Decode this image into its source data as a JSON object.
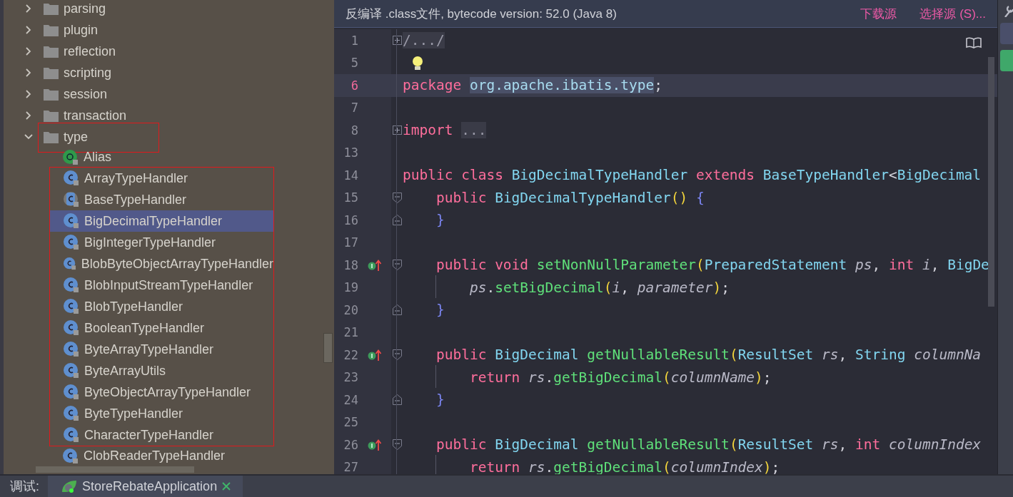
{
  "project_tree": {
    "items": [
      {
        "label": "parsing",
        "kind": "folder",
        "expanded": false,
        "selected": false,
        "outlined": false
      },
      {
        "label": "plugin",
        "kind": "folder",
        "expanded": false,
        "selected": false,
        "outlined": false
      },
      {
        "label": "reflection",
        "kind": "folder",
        "expanded": false,
        "selected": false,
        "outlined": false
      },
      {
        "label": "scripting",
        "kind": "folder",
        "expanded": false,
        "selected": false,
        "outlined": false
      },
      {
        "label": "session",
        "kind": "folder",
        "expanded": false,
        "selected": false,
        "outlined": false
      },
      {
        "label": "transaction",
        "kind": "folder",
        "expanded": false,
        "selected": false,
        "outlined": false
      },
      {
        "label": "type",
        "kind": "folder",
        "expanded": true,
        "selected": false,
        "outlined": true,
        "children": [
          {
            "label": "Alias",
            "kind": "annotation",
            "selected": false,
            "boxed": false
          },
          {
            "label": "ArrayTypeHandler",
            "kind": "class",
            "selected": false,
            "boxed": true
          },
          {
            "label": "BaseTypeHandler",
            "kind": "abstract",
            "selected": false,
            "boxed": true
          },
          {
            "label": "BigDecimalTypeHandler",
            "kind": "class",
            "selected": true,
            "boxed": true
          },
          {
            "label": "BigIntegerTypeHandler",
            "kind": "class",
            "selected": false,
            "boxed": true
          },
          {
            "label": "BlobByteObjectArrayTypeHandler",
            "kind": "class",
            "selected": false,
            "boxed": true
          },
          {
            "label": "BlobInputStreamTypeHandler",
            "kind": "class",
            "selected": false,
            "boxed": true
          },
          {
            "label": "BlobTypeHandler",
            "kind": "class",
            "selected": false,
            "boxed": true
          },
          {
            "label": "BooleanTypeHandler",
            "kind": "class",
            "selected": false,
            "boxed": true
          },
          {
            "label": "ByteArrayTypeHandler",
            "kind": "class",
            "selected": false,
            "boxed": true
          },
          {
            "label": "ByteArrayUtils",
            "kind": "class",
            "selected": false,
            "boxed": true
          },
          {
            "label": "ByteObjectArrayTypeHandler",
            "kind": "class",
            "selected": false,
            "boxed": true
          },
          {
            "label": "ByteTypeHandler",
            "kind": "class",
            "selected": false,
            "boxed": true
          },
          {
            "label": "CharacterTypeHandler",
            "kind": "class",
            "selected": false,
            "boxed": true
          },
          {
            "label": "ClobReaderTypeHandler",
            "kind": "class",
            "selected": false,
            "boxed": false
          }
        ]
      }
    ]
  },
  "editor": {
    "banner": {
      "text": "反编译 .class文件, bytecode version: 52.0 (Java 8)",
      "links": [
        "下载源",
        "选择源 (S)..."
      ]
    },
    "lines": [
      {
        "n": "1",
        "kind": "collapsed",
        "current": false,
        "tokens": [
          {
            "kind": "folded",
            "text": "/.../"
          }
        ]
      },
      {
        "n": "5",
        "kind": "hint",
        "current": false
      },
      {
        "n": "6",
        "kind": "code",
        "current": true,
        "tokens": [
          {
            "kind": "keyword",
            "text": "package "
          },
          {
            "kind": "selected",
            "text": "org.apache.ibatis.type"
          },
          {
            "kind": "plain",
            "text": ";"
          }
        ]
      },
      {
        "n": "7",
        "kind": "blank",
        "current": false
      },
      {
        "n": "8",
        "kind": "collapsed",
        "current": false,
        "tokens": [
          {
            "kind": "keyword",
            "text": "import "
          },
          {
            "kind": "folded",
            "text": "..."
          }
        ]
      },
      {
        "n": "13",
        "kind": "blank",
        "current": false
      },
      {
        "n": "14",
        "kind": "code",
        "current": false,
        "tokens": [
          {
            "kind": "keyword",
            "text": "public class "
          },
          {
            "kind": "type",
            "text": "BigDecimalTypeHandler"
          },
          {
            "kind": "keyword",
            "text": " extends "
          },
          {
            "kind": "type",
            "text": "BaseTypeHandler"
          },
          {
            "kind": "plain",
            "text": "<"
          },
          {
            "kind": "type",
            "text": "BigDecimal"
          }
        ]
      },
      {
        "n": "15",
        "kind": "block-start",
        "current": false,
        "tokens": [
          {
            "kind": "keyword",
            "text": "public "
          },
          {
            "kind": "type",
            "text": "BigDecimalTypeHandler"
          },
          {
            "kind": "paren",
            "text": "() "
          },
          {
            "kind": "brace",
            "text": "{"
          }
        ]
      },
      {
        "n": "16",
        "kind": "block-end",
        "current": false,
        "tokens": [
          {
            "kind": "brace",
            "text": "}"
          }
        ]
      },
      {
        "n": "17",
        "kind": "blank",
        "current": false
      },
      {
        "n": "18",
        "kind": "method-start",
        "current": false,
        "tokens": [
          {
            "kind": "keyword",
            "text": "public void "
          },
          {
            "kind": "method",
            "text": "setNonNullParameter"
          },
          {
            "kind": "paren",
            "text": "("
          },
          {
            "kind": "type",
            "text": "PreparedStatement "
          },
          {
            "kind": "param",
            "text": "ps"
          },
          {
            "kind": "plain",
            "text": ", "
          },
          {
            "kind": "keyword",
            "text": "int "
          },
          {
            "kind": "param",
            "text": "i"
          },
          {
            "kind": "plain",
            "text": ", "
          },
          {
            "kind": "type",
            "text": "BigDe"
          }
        ]
      },
      {
        "n": "19",
        "kind": "body",
        "current": false,
        "tokens": [
          {
            "kind": "param",
            "text": "ps"
          },
          {
            "kind": "plain",
            "text": "."
          },
          {
            "kind": "method",
            "text": "setBigDecimal"
          },
          {
            "kind": "paren",
            "text": "("
          },
          {
            "kind": "param",
            "text": "i"
          },
          {
            "kind": "plain",
            "text": ", "
          },
          {
            "kind": "param",
            "text": "parameter"
          },
          {
            "kind": "paren",
            "text": ")"
          },
          {
            "kind": "plain",
            "text": ";"
          }
        ]
      },
      {
        "n": "20",
        "kind": "block-end",
        "current": false,
        "tokens": [
          {
            "kind": "brace",
            "text": "}"
          }
        ]
      },
      {
        "n": "21",
        "kind": "blank",
        "current": false
      },
      {
        "n": "22",
        "kind": "method-start",
        "current": false,
        "tokens": [
          {
            "kind": "keyword",
            "text": "public "
          },
          {
            "kind": "type",
            "text": "BigDecimal "
          },
          {
            "kind": "method",
            "text": "getNullableResult"
          },
          {
            "kind": "paren",
            "text": "("
          },
          {
            "kind": "type",
            "text": "ResultSet "
          },
          {
            "kind": "param",
            "text": "rs"
          },
          {
            "kind": "plain",
            "text": ", "
          },
          {
            "kind": "type",
            "text": "String "
          },
          {
            "kind": "param",
            "text": "columnNa"
          }
        ]
      },
      {
        "n": "23",
        "kind": "body",
        "current": false,
        "tokens": [
          {
            "kind": "keyword",
            "text": "return "
          },
          {
            "kind": "param",
            "text": "rs"
          },
          {
            "kind": "plain",
            "text": "."
          },
          {
            "kind": "method",
            "text": "getBigDecimal"
          },
          {
            "kind": "paren",
            "text": "("
          },
          {
            "kind": "param",
            "text": "columnName"
          },
          {
            "kind": "paren",
            "text": ")"
          },
          {
            "kind": "plain",
            "text": ";"
          }
        ]
      },
      {
        "n": "24",
        "kind": "block-end",
        "current": false,
        "tokens": [
          {
            "kind": "brace",
            "text": "}"
          }
        ]
      },
      {
        "n": "25",
        "kind": "blank",
        "current": false
      },
      {
        "n": "26",
        "kind": "method-start",
        "current": false,
        "tokens": [
          {
            "kind": "keyword",
            "text": "public "
          },
          {
            "kind": "type",
            "text": "BigDecimal "
          },
          {
            "kind": "method",
            "text": "getNullableResult"
          },
          {
            "kind": "paren",
            "text": "("
          },
          {
            "kind": "type",
            "text": "ResultSet "
          },
          {
            "kind": "param",
            "text": "rs"
          },
          {
            "kind": "plain",
            "text": ", "
          },
          {
            "kind": "keyword",
            "text": "int "
          },
          {
            "kind": "param",
            "text": "columnIndex"
          }
        ]
      },
      {
        "n": "27",
        "kind": "body",
        "current": false,
        "tokens": [
          {
            "kind": "keyword",
            "text": "return "
          },
          {
            "kind": "param",
            "text": "rs"
          },
          {
            "kind": "plain",
            "text": "."
          },
          {
            "kind": "method",
            "text": "getBigDecimal"
          },
          {
            "kind": "paren",
            "text": "("
          },
          {
            "kind": "param",
            "text": "columnIndex"
          },
          {
            "kind": "paren",
            "text": ")"
          },
          {
            "kind": "plain",
            "text": ";"
          }
        ]
      }
    ]
  },
  "bottom_bar": {
    "label": "调试:",
    "tabs": [
      {
        "label": "StoreRebateApplication",
        "selected": true
      }
    ]
  }
}
